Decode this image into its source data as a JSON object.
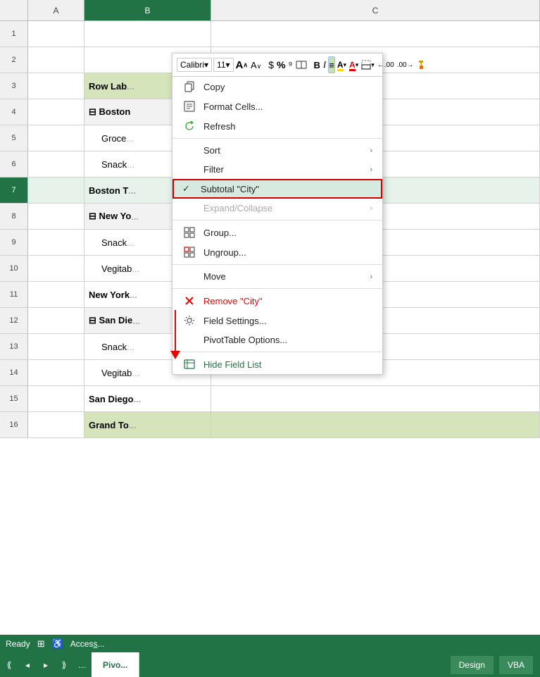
{
  "spreadsheet": {
    "col_headers": [
      "A",
      "B",
      "C"
    ],
    "rows": [
      {
        "num": "1",
        "a": "",
        "b": "",
        "c": "",
        "type": "normal"
      },
      {
        "num": "2",
        "a": "",
        "b": "",
        "c": "",
        "type": "normal"
      },
      {
        "num": "3",
        "a": "",
        "b": "Row Labels",
        "c": "",
        "type": "header"
      },
      {
        "num": "4",
        "a": "",
        "b": "⊟ Boston",
        "c": "",
        "type": "city-header"
      },
      {
        "num": "5",
        "a": "",
        "b": "Groce...",
        "c": "",
        "type": "indent"
      },
      {
        "num": "6",
        "a": "",
        "b": "Snack...",
        "c": "",
        "type": "indent"
      },
      {
        "num": "7",
        "a": "",
        "b": "Boston T...",
        "c": "",
        "type": "subtotal",
        "selected": true
      },
      {
        "num": "8",
        "a": "",
        "b": "⊟ New Yo...",
        "c": "",
        "type": "city-header"
      },
      {
        "num": "9",
        "a": "",
        "b": "Snack...",
        "c": "",
        "type": "indent"
      },
      {
        "num": "10",
        "a": "",
        "b": "Vegitab...",
        "c": "",
        "type": "indent"
      },
      {
        "num": "11",
        "a": "",
        "b": "New York...",
        "c": "",
        "type": "subtotal"
      },
      {
        "num": "12",
        "a": "",
        "b": "⊟ San Die...",
        "c": "",
        "type": "city-header"
      },
      {
        "num": "13",
        "a": "",
        "b": "Snack...",
        "c": "",
        "type": "indent"
      },
      {
        "num": "14",
        "a": "",
        "b": "Vegitab...",
        "c": "",
        "type": "indent"
      },
      {
        "num": "15",
        "a": "",
        "b": "San Diego...",
        "c": "",
        "type": "subtotal"
      },
      {
        "num": "16",
        "a": "",
        "b": "Grand To...",
        "c": "",
        "type": "grand-total"
      }
    ]
  },
  "format_toolbar": {
    "font": "Calibri",
    "font_dropdown": "▾",
    "size": "11",
    "size_dropdown": "▾",
    "grow_icon": "A↑",
    "shrink_icon": "A↓",
    "currency_icon": "$",
    "percent_icon": "%",
    "comma_icon": "⁹",
    "accounting_icon": "⇔",
    "bold": "B",
    "italic": "I",
    "align_icon": "≡",
    "highlight_icon": "A",
    "font_color_icon": "A",
    "border_icon": "□",
    "dec_left": "←.00",
    "dec_right": ".00→",
    "paint_icon": "🖌"
  },
  "context_menu": {
    "items": [
      {
        "id": "copy",
        "label": "Copy",
        "icon": "copy",
        "has_submenu": false,
        "disabled": false,
        "check": ""
      },
      {
        "id": "format-cells",
        "label": "Format Cells...",
        "icon": "format",
        "has_submenu": false,
        "disabled": false,
        "check": ""
      },
      {
        "id": "refresh",
        "label": "Refresh",
        "icon": "refresh",
        "has_submenu": false,
        "disabled": false,
        "check": ""
      },
      {
        "id": "sep1",
        "label": "",
        "type": "separator"
      },
      {
        "id": "sort",
        "label": "Sort",
        "icon": "",
        "has_submenu": true,
        "disabled": false,
        "check": ""
      },
      {
        "id": "filter",
        "label": "Filter",
        "icon": "",
        "has_submenu": true,
        "disabled": false,
        "check": ""
      },
      {
        "id": "subtotal-city",
        "label": "Subtotal \"City\"",
        "icon": "",
        "has_submenu": false,
        "disabled": false,
        "check": "✓",
        "highlighted": true
      },
      {
        "id": "expand-collapse",
        "label": "Expand/Collapse",
        "icon": "",
        "has_submenu": true,
        "disabled": true,
        "check": ""
      },
      {
        "id": "sep2",
        "label": "",
        "type": "separator"
      },
      {
        "id": "group",
        "label": "Group...",
        "icon": "group",
        "has_submenu": false,
        "disabled": false,
        "check": ""
      },
      {
        "id": "ungroup",
        "label": "Ungroup...",
        "icon": "ungroup",
        "has_submenu": false,
        "disabled": false,
        "check": ""
      },
      {
        "id": "sep3",
        "label": "",
        "type": "separator"
      },
      {
        "id": "move",
        "label": "Move",
        "icon": "",
        "has_submenu": true,
        "disabled": false,
        "check": ""
      },
      {
        "id": "sep4",
        "label": "",
        "type": "separator"
      },
      {
        "id": "remove-city",
        "label": "Remove \"City\"",
        "icon": "x",
        "has_submenu": false,
        "disabled": false,
        "check": ""
      },
      {
        "id": "field-settings",
        "label": "Field Settings...",
        "icon": "field-settings",
        "has_submenu": false,
        "disabled": false,
        "check": ""
      },
      {
        "id": "pivottable-options",
        "label": "PivotTable Options...",
        "icon": "",
        "has_submenu": false,
        "disabled": false,
        "check": ""
      },
      {
        "id": "sep5",
        "label": "",
        "type": "separator"
      },
      {
        "id": "hide-field-list",
        "label": "Hide Field List",
        "icon": "hide-field",
        "has_submenu": false,
        "disabled": false,
        "check": ""
      }
    ]
  },
  "tabs": {
    "sheet": "Pivo...",
    "design": "Design",
    "vba": "VBA"
  },
  "status": {
    "ready": "Ready"
  }
}
